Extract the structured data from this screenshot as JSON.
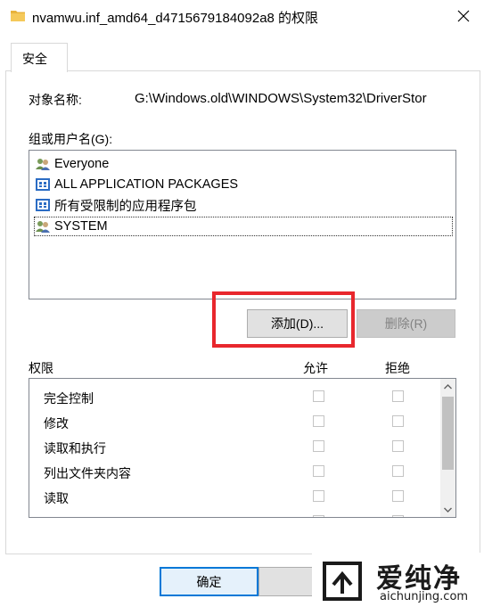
{
  "window": {
    "title": "nvamwu.inf_amd64_d4715679184092a8 的权限",
    "close_icon": "close-icon"
  },
  "tabs": [
    {
      "label": "安全",
      "active": true
    }
  ],
  "object": {
    "label": "对象名称:",
    "value": "G:\\Windows.old\\WINDOWS\\System32\\DriverStor"
  },
  "groups": {
    "label": "组或用户名(G):",
    "items": [
      {
        "name": "Everyone",
        "icon": "users-icon"
      },
      {
        "name": "ALL APPLICATION PACKAGES",
        "icon": "package-group-icon"
      },
      {
        "name": "所有受限制的应用程序包",
        "icon": "package-group-icon"
      },
      {
        "name": "SYSTEM",
        "icon": "users-icon",
        "selected": true
      }
    ]
  },
  "buttons": {
    "add": "添加(D)...",
    "remove": "删除(R)",
    "ok": "确定"
  },
  "permissions": {
    "label": "权限",
    "allow_header": "允许",
    "deny_header": "拒绝",
    "items": [
      {
        "name": "完全控制",
        "allow": false,
        "deny": false
      },
      {
        "name": "修改",
        "allow": false,
        "deny": false
      },
      {
        "name": "读取和执行",
        "allow": false,
        "deny": false
      },
      {
        "name": "列出文件夹内容",
        "allow": false,
        "deny": false
      },
      {
        "name": "读取",
        "allow": false,
        "deny": false
      }
    ]
  },
  "watermark": {
    "cn": "爱纯净",
    "en": "aichunjing.com"
  },
  "colors": {
    "highlight_border": "#e8272d",
    "accent": "#0078d7"
  }
}
